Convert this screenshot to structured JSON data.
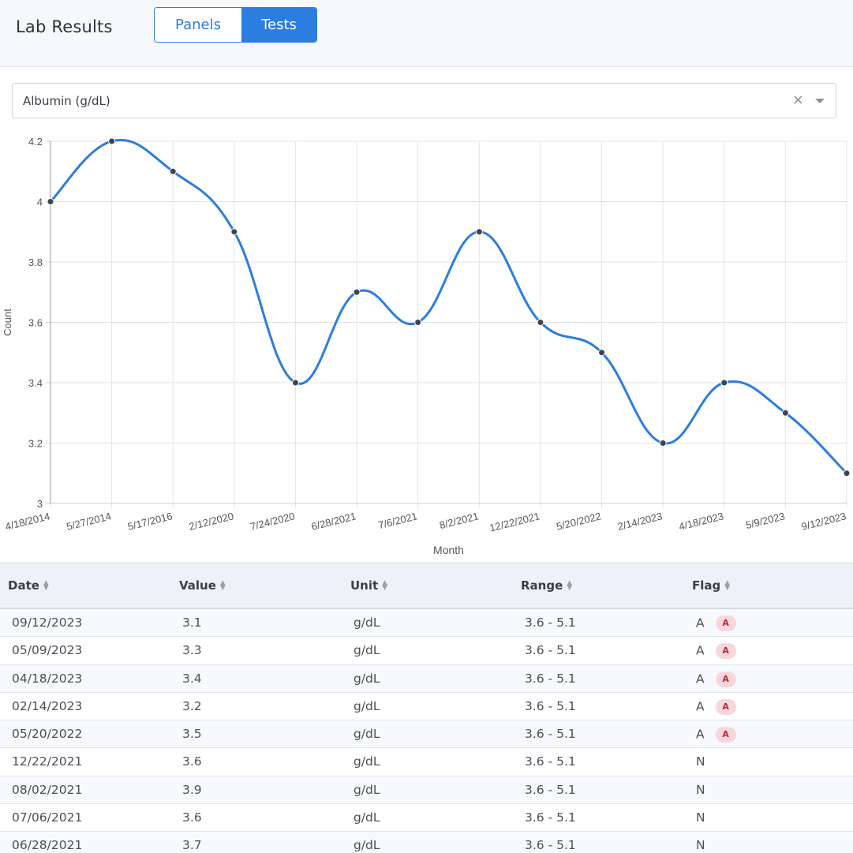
{
  "header": {
    "title": "Lab Results",
    "toggle": {
      "panels_label": "Panels",
      "tests_label": "Tests",
      "active": "Tests"
    }
  },
  "test_select": {
    "value": "Albumin (g/dL)",
    "clear_icon": "close-icon",
    "caret_icon": "chevron-down-icon"
  },
  "chart_data": {
    "type": "line",
    "title": "",
    "xlabel": "Month",
    "ylabel": "Count",
    "ylim": [
      3,
      4.2
    ],
    "yticks": [
      "3",
      "3.2",
      "3.4",
      "3.6",
      "3.8",
      "4",
      "4.2"
    ],
    "grid": true,
    "x": [
      "4/18/2014",
      "5/27/2014",
      "5/17/2016",
      "2/12/2020",
      "7/24/2020",
      "6/28/2021",
      "7/6/2021",
      "8/2/2021",
      "12/22/2021",
      "5/20/2022",
      "2/14/2023",
      "4/18/2023",
      "5/9/2023",
      "9/12/2023"
    ],
    "series": [
      {
        "values": [
          4.0,
          4.2,
          4.1,
          3.9,
          3.4,
          3.7,
          3.6,
          3.9,
          3.6,
          3.5,
          3.2,
          3.4,
          3.3,
          3.1
        ]
      }
    ],
    "colors": {
      "line": "#2b7de0",
      "point": "#3d4450"
    }
  },
  "table": {
    "columns": [
      "Date",
      "Value",
      "Unit",
      "Range",
      "Flag"
    ],
    "rows": [
      {
        "date": "09/12/2023",
        "value": "3.1",
        "unit": "g/dL",
        "range": "3.6 - 5.1",
        "flag": "A",
        "badge": "A"
      },
      {
        "date": "05/09/2023",
        "value": "3.3",
        "unit": "g/dL",
        "range": "3.6 - 5.1",
        "flag": "A",
        "badge": "A"
      },
      {
        "date": "04/18/2023",
        "value": "3.4",
        "unit": "g/dL",
        "range": "3.6 - 5.1",
        "flag": "A",
        "badge": "A"
      },
      {
        "date": "02/14/2023",
        "value": "3.2",
        "unit": "g/dL",
        "range": "3.6 - 5.1",
        "flag": "A",
        "badge": "A"
      },
      {
        "date": "05/20/2022",
        "value": "3.5",
        "unit": "g/dL",
        "range": "3.6 - 5.1",
        "flag": "A",
        "badge": "A"
      },
      {
        "date": "12/22/2021",
        "value": "3.6",
        "unit": "g/dL",
        "range": "3.6 - 5.1",
        "flag": "N",
        "badge": ""
      },
      {
        "date": "08/02/2021",
        "value": "3.9",
        "unit": "g/dL",
        "range": "3.6 - 5.1",
        "flag": "N",
        "badge": ""
      },
      {
        "date": "07/06/2021",
        "value": "3.6",
        "unit": "g/dL",
        "range": "3.6 - 5.1",
        "flag": "N",
        "badge": ""
      },
      {
        "date": "06/28/2021",
        "value": "3.7",
        "unit": "g/dL",
        "range": "3.6 - 5.1",
        "flag": "N",
        "badge": ""
      }
    ],
    "colors": {
      "badge_bg": "#f8d7dc",
      "badge_text": "#b3293d"
    }
  }
}
